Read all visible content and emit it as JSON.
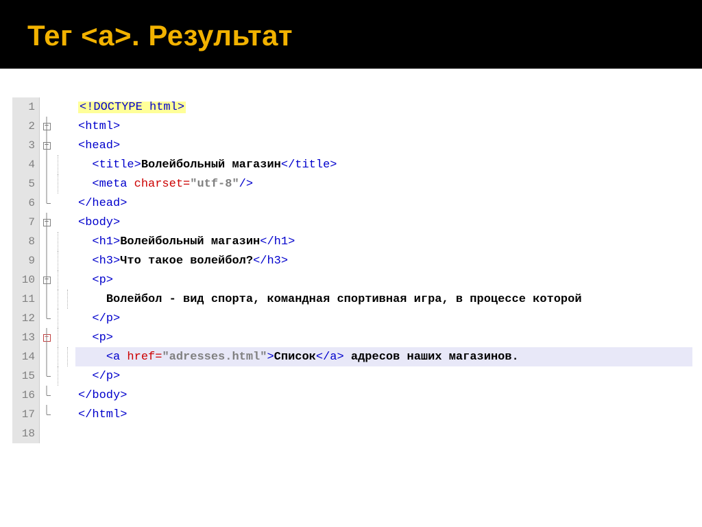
{
  "slide": {
    "title": "Тег <a>. Результат"
  },
  "code": {
    "lines": [
      {
        "n": "1",
        "fold": "",
        "guide": 0,
        "indent": 0,
        "tokens": [
          {
            "c": "t-tag t-doctype-bg",
            "t": "<!DOCTYPE html>"
          }
        ]
      },
      {
        "n": "2",
        "fold": "minus",
        "guide": 0,
        "indent": 0,
        "tokens": [
          {
            "c": "t-tag",
            "t": "<html>"
          }
        ]
      },
      {
        "n": "3",
        "fold": "minus",
        "guide": 0,
        "indent": 0,
        "tokens": [
          {
            "c": "t-tag",
            "t": "<head>"
          }
        ]
      },
      {
        "n": "4",
        "fold": "line",
        "guide": 1,
        "indent": 1,
        "tokens": [
          {
            "c": "t-tag",
            "t": "<title>"
          },
          {
            "c": "t-text",
            "t": "Волейбольный магазин"
          },
          {
            "c": "t-tag",
            "t": "</title>"
          }
        ]
      },
      {
        "n": "5",
        "fold": "line",
        "guide": 1,
        "indent": 1,
        "tokens": [
          {
            "c": "t-tag",
            "t": "<meta "
          },
          {
            "c": "t-attr",
            "t": "charset="
          },
          {
            "c": "t-str",
            "t": "\"utf-8\""
          },
          {
            "c": "t-tag",
            "t": "/>"
          }
        ]
      },
      {
        "n": "6",
        "fold": "end",
        "guide": 0,
        "indent": 0,
        "tokens": [
          {
            "c": "t-tag",
            "t": "</head>"
          }
        ]
      },
      {
        "n": "7",
        "fold": "minus",
        "guide": 0,
        "indent": 0,
        "tokens": [
          {
            "c": "t-tag",
            "t": "<body>"
          }
        ]
      },
      {
        "n": "8",
        "fold": "line",
        "guide": 1,
        "indent": 1,
        "tokens": [
          {
            "c": "t-tag",
            "t": "<h1>"
          },
          {
            "c": "t-text",
            "t": "Волейбольный магазин"
          },
          {
            "c": "t-tag",
            "t": "</h1>"
          }
        ]
      },
      {
        "n": "9",
        "fold": "line",
        "guide": 1,
        "indent": 1,
        "tokens": [
          {
            "c": "t-tag",
            "t": "<h3>"
          },
          {
            "c": "t-text",
            "t": "Что такое волейбол?"
          },
          {
            "c": "t-tag",
            "t": "</h3>"
          }
        ]
      },
      {
        "n": "10",
        "fold": "minus",
        "guide": 1,
        "indent": 1,
        "tokens": [
          {
            "c": "t-tag",
            "t": "<p>"
          }
        ]
      },
      {
        "n": "11",
        "fold": "line",
        "guide": 2,
        "indent": 2,
        "tokens": [
          {
            "c": "t-text",
            "t": "Волейбол - вид спорта, командная спортивная игра, в процессе которой"
          }
        ]
      },
      {
        "n": "12",
        "fold": "end",
        "guide": 1,
        "indent": 1,
        "tokens": [
          {
            "c": "t-tag",
            "t": "</p>"
          }
        ]
      },
      {
        "n": "13",
        "fold": "minus-red",
        "guide": 1,
        "indent": 1,
        "tokens": [
          {
            "c": "t-tag",
            "t": "<p>"
          }
        ]
      },
      {
        "n": "14",
        "fold": "line",
        "guide": 2,
        "indent": 2,
        "hl": true,
        "tokens": [
          {
            "c": "t-tag",
            "t": "<a "
          },
          {
            "c": "t-attr",
            "t": "href="
          },
          {
            "c": "t-str",
            "t": "\"adresses.html\""
          },
          {
            "c": "t-tag",
            "t": ">"
          },
          {
            "c": "t-text",
            "t": "Список"
          },
          {
            "c": "t-tag",
            "t": "</a>"
          },
          {
            "c": "t-text",
            "t": " адресов наших магазинов."
          }
        ]
      },
      {
        "n": "15",
        "fold": "end",
        "guide": 1,
        "indent": 1,
        "tokens": [
          {
            "c": "t-tag",
            "t": "</p>"
          }
        ]
      },
      {
        "n": "16",
        "fold": "end",
        "guide": 0,
        "indent": 0,
        "tokens": [
          {
            "c": "t-tag",
            "t": "</body>"
          }
        ]
      },
      {
        "n": "17",
        "fold": "end",
        "guide": 0,
        "indent": 0,
        "tokens": [
          {
            "c": "t-tag",
            "t": "</html>"
          }
        ]
      },
      {
        "n": "18",
        "fold": "",
        "guide": 0,
        "indent": 0,
        "tokens": []
      }
    ]
  }
}
